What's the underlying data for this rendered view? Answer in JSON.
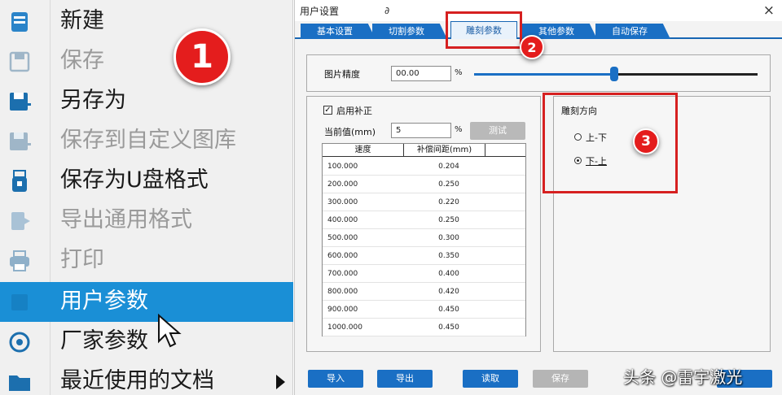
{
  "menu": {
    "items": [
      {
        "label": "新建",
        "icon": "new-file-icon",
        "disabled": false
      },
      {
        "label": "保存",
        "icon": "save-icon",
        "disabled": true
      },
      {
        "label": "另存为",
        "icon": "save-as-icon",
        "disabled": false
      },
      {
        "label": "保存到自定义图库",
        "icon": "save-to-library-icon",
        "disabled": true
      },
      {
        "label": "保存为U盘格式",
        "icon": "usb-drive-icon",
        "disabled": false
      },
      {
        "label": "导出通用格式",
        "icon": "export-icon",
        "disabled": true
      },
      {
        "label": "打印",
        "icon": "printer-icon",
        "disabled": true
      },
      {
        "label": "用户参数",
        "icon": "user-params-icon",
        "disabled": false,
        "highlighted": true
      },
      {
        "label": "厂家参数",
        "icon": "vendor-params-icon",
        "disabled": false
      },
      {
        "label": "最近使用的文档",
        "icon": "folder-icon",
        "disabled": false,
        "has_submenu": true
      }
    ],
    "highlight_color": "#1a8fd6"
  },
  "callouts": {
    "one": "1",
    "two": "2",
    "three": "3",
    "color": "#e41d1d"
  },
  "dialog": {
    "title": "用户设置",
    "title_glyph": "∂",
    "close": "×",
    "tabs": [
      {
        "label": "基本设置",
        "active": false
      },
      {
        "label": "切割参数",
        "active": false
      },
      {
        "label": "雕刻参数",
        "active": true
      },
      {
        "label": "其他参数",
        "active": false
      },
      {
        "label": "自动保存",
        "active": false
      }
    ],
    "top_row": {
      "label": "图片精度",
      "value": "00.00",
      "unit": "%",
      "slider_value": 0.59
    },
    "left": {
      "checkbox_label": "启用补正",
      "checkbox_mark": "✓",
      "field_label": "当前值(mm)",
      "field_value": "5",
      "field_unit": "%",
      "test_button": "测试",
      "table": {
        "columns": [
          "速度",
          "补偿间距(mm)"
        ],
        "rows": [
          [
            "100.000",
            "0.204"
          ],
          [
            "200.000",
            "0.250"
          ],
          [
            "300.000",
            "0.220"
          ],
          [
            "400.000",
            "0.250"
          ],
          [
            "500.000",
            "0.300"
          ],
          [
            "600.000",
            "0.350"
          ],
          [
            "700.000",
            "0.400"
          ],
          [
            "800.000",
            "0.420"
          ],
          [
            "900.000",
            "0.450"
          ],
          [
            "1000.000",
            "0.450"
          ]
        ]
      }
    },
    "right": {
      "group_label": "雕刻方向",
      "options": [
        {
          "label": "上-下",
          "selected": false
        },
        {
          "label": "下-上",
          "selected": true
        }
      ]
    },
    "buttons": [
      {
        "label": "导入",
        "disabled": false
      },
      {
        "label": "导出",
        "disabled": false
      },
      {
        "label": "读取",
        "disabled": false
      },
      {
        "label": "保存",
        "disabled": true
      }
    ]
  },
  "watermark": "头条 @雷宇激光"
}
